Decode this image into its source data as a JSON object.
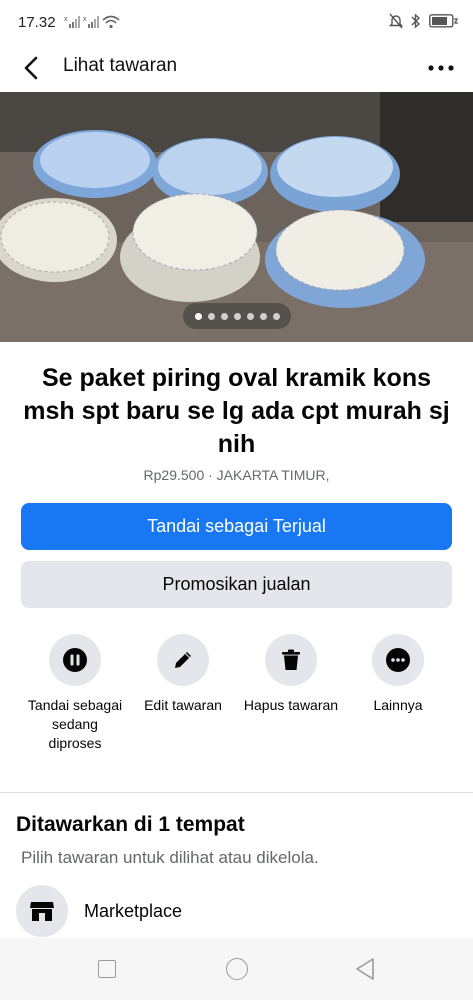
{
  "status_bar": {
    "time": "17.32",
    "icons": [
      "sim1-signal-icon",
      "sim2-signal-icon",
      "wifi-icon",
      "silent-bell-icon",
      "bluetooth-icon",
      "battery-icon"
    ]
  },
  "top_bar": {
    "title": "Lihat tawaran",
    "back_icon": "chevron-left-icon",
    "more_icon": "more-horizontal-icon"
  },
  "photo": {
    "description_icon": "listing-photo",
    "carousel": {
      "total": 7,
      "active_index": 0
    }
  },
  "listing": {
    "title": "Se paket piring oval kramik kons msh spt baru se lg ada cpt murah sj nih",
    "meta": "Rp29.500 · JAKARTA TIMUR,"
  },
  "buttons": {
    "primary_label": "Tandai sebagai Terjual",
    "secondary_label": "Promosikan jualan"
  },
  "actions": [
    {
      "label": "Tandai sebagai sedang diproses",
      "icon": "pause-icon"
    },
    {
      "label": "Edit tawaran",
      "icon": "pencil-icon"
    },
    {
      "label": "Hapus tawaran",
      "icon": "trash-icon"
    },
    {
      "label": "Lainnya",
      "icon": "more-horizontal-icon"
    }
  ],
  "section": {
    "title": "Ditawarkan di 1 tempat",
    "subtitle": "Pilih tawaran untuk dilihat atau dikelola."
  },
  "marketplace": {
    "label": "Marketplace",
    "icon": "storefront-icon"
  },
  "nav_bar": {
    "icons": [
      "recent-apps-icon",
      "home-icon",
      "back-triangle-icon"
    ]
  },
  "colors": {
    "primary": "#1877f2",
    "secondary_bg": "#e4e6eb",
    "muted_text": "#65676b"
  }
}
